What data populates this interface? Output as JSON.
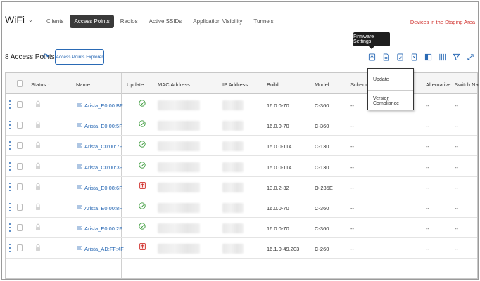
{
  "app": {
    "title": "WiFi"
  },
  "tabs": [
    {
      "label": "Clients",
      "active": false
    },
    {
      "label": "Access Points",
      "active": true
    },
    {
      "label": "Radios",
      "active": false
    },
    {
      "label": "Active SSIDs",
      "active": false
    },
    {
      "label": "Application Visibility",
      "active": false
    },
    {
      "label": "Tunnels",
      "active": false
    }
  ],
  "header": {
    "staging_link": "Devices in the Staging Area"
  },
  "tooltip": {
    "text": "Firmware Settings"
  },
  "subbar": {
    "count_label": "8 Access Points",
    "explorer_button": "Access Points Explorer"
  },
  "toolbar_icons": [
    "firmware-upload-icon",
    "document-icon",
    "export-icon",
    "delete-icon",
    "column-layout-icon",
    "columns-icon",
    "filter-icon",
    "expand-icon"
  ],
  "dropdown": {
    "items": [
      "Update",
      "Version Compliance"
    ]
  },
  "table": {
    "columns": {
      "status": "Status ↑",
      "name": "Name",
      "update": "Update",
      "mac": "MAC Address",
      "ip": "IP Address",
      "build": "Build",
      "model": "Model",
      "schedule": "Schedule",
      "alternative": "Alternative...",
      "switch": "Switch Na..."
    },
    "rows": [
      {
        "name": "Arista_E0:00:BF",
        "update": "ok",
        "build": "16.0.0-70",
        "model": "C-360",
        "schedule": "--",
        "alternative": "--",
        "switch": "--"
      },
      {
        "name": "Arista_E0:00:5F",
        "update": "ok",
        "build": "16.0.0-70",
        "model": "C-360",
        "schedule": "--",
        "alternative": "--",
        "switch": "--"
      },
      {
        "name": "Arista_C0:00:7F",
        "update": "ok",
        "build": "15.0.0-114",
        "model": "C-130",
        "schedule": "--",
        "alternative": "--",
        "switch": "--"
      },
      {
        "name": "Arista_C0:00:3F",
        "update": "ok",
        "build": "15.0.0-114",
        "model": "C-130",
        "schedule": "--",
        "alternative": "--",
        "switch": "--"
      },
      {
        "name": "Arista_E0:08:6F",
        "update": "available",
        "build": "13.0.2-32",
        "model": "O-235E",
        "schedule": "--",
        "alternative": "--",
        "switch": "--"
      },
      {
        "name": "Arista_E0:00:8F",
        "update": "ok",
        "build": "16.0.0-70",
        "model": "C-360",
        "schedule": "--",
        "alternative": "--",
        "switch": "--"
      },
      {
        "name": "Arista_E0:00:2F",
        "update": "ok",
        "build": "16.0.0-70",
        "model": "C-360",
        "schedule": "--",
        "alternative": "--",
        "switch": "--"
      },
      {
        "name": "Arista_AD:FF:4F",
        "update": "available",
        "build": "16.1.0-49.203",
        "model": "C-260",
        "schedule": "--",
        "alternative": "--",
        "switch": "--"
      }
    ]
  },
  "colors": {
    "accent": "#2a6ab5",
    "ok": "#3a9a3a",
    "alert": "#d0312d"
  }
}
